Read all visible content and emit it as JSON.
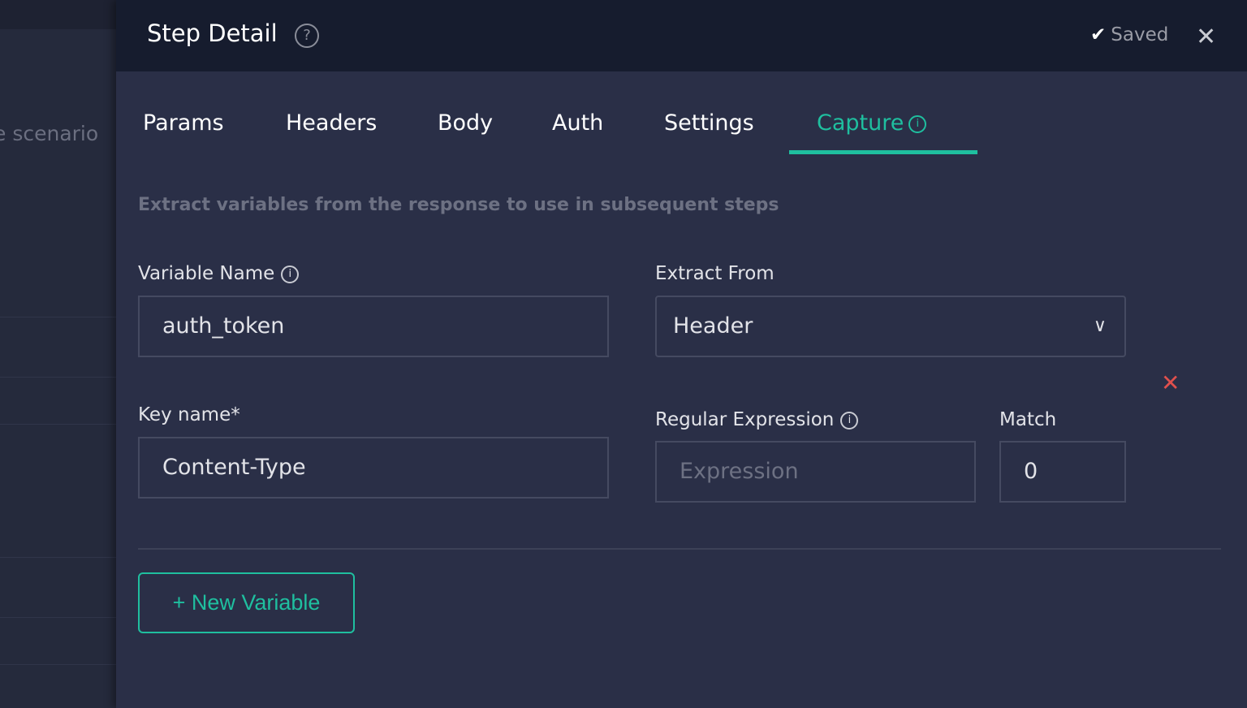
{
  "background": {
    "text": "e scenario"
  },
  "header": {
    "title": "Step Detail",
    "help_icon": "?",
    "saved": "Saved",
    "check_icon": "✔",
    "close_icon": "✕"
  },
  "tabs": [
    {
      "label": "Params"
    },
    {
      "label": "Headers"
    },
    {
      "label": "Body"
    },
    {
      "label": "Auth"
    },
    {
      "label": "Settings"
    },
    {
      "label": "Capture",
      "active": true
    }
  ],
  "info_icon": "i",
  "description": "Extract variables from the response to use in subsequent steps",
  "form": {
    "variable_name_label": "Variable Name",
    "variable_name_value": "auth_token",
    "extract_from_label": "Extract From",
    "extract_from_value": "Header",
    "key_name_label": "Key name*",
    "key_name_value": "Content-Type",
    "regex_label": "Regular Expression",
    "regex_placeholder": "Expression",
    "match_label": "Match",
    "match_value": "0",
    "delete_icon": "✕"
  },
  "new_variable_button": "+ New Variable",
  "colors": {
    "accent": "#1fbf9f",
    "danger": "#e0504d",
    "header": "#161c2e",
    "panel": "#2a2f47"
  }
}
